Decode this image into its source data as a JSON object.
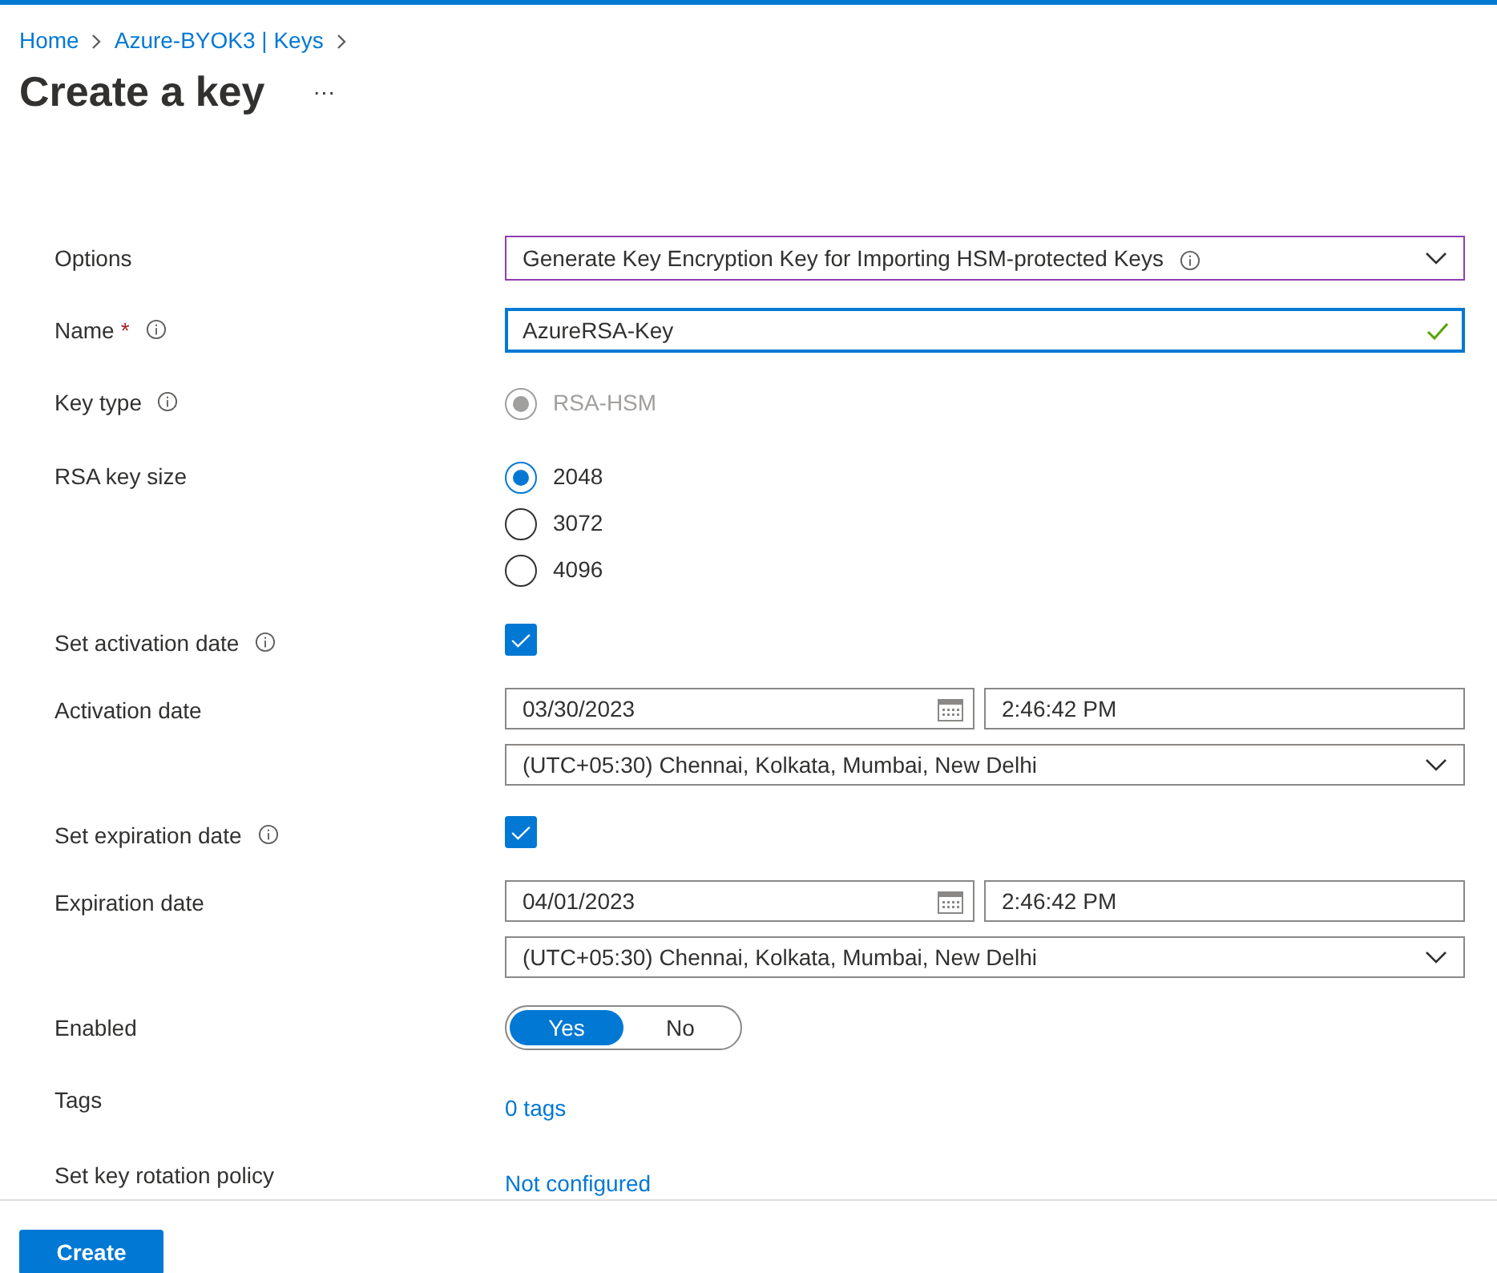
{
  "breadcrumb": [
    {
      "label": "Home"
    },
    {
      "label": "Azure-BYOK3 | Keys"
    }
  ],
  "title": "Create a key",
  "more": "···",
  "fields": [
    {
      "kind": "dropdown",
      "label": "Options",
      "value": "Generate Key Encryption Key for Importing HSM-protected Keys",
      "value_info": true
    },
    {
      "kind": "text",
      "label": "Name",
      "required_mark": "*",
      "info": true,
      "value": "AzureRSA-Key",
      "focused": true,
      "valid": true
    },
    {
      "kind": "radio",
      "label": "Key type",
      "info": true,
      "options": [
        {
          "label": "RSA-HSM",
          "selected": true,
          "disabled": true
        }
      ]
    },
    {
      "kind": "radio",
      "label": "RSA key size",
      "options": [
        {
          "label": "2048",
          "selected": true,
          "disabled": false
        },
        {
          "label": "3072",
          "selected": false,
          "disabled": false
        },
        {
          "label": "4096",
          "selected": false,
          "disabled": false
        }
      ]
    },
    {
      "kind": "checkbox",
      "label": "Set activation date",
      "info": true,
      "checked": true
    },
    {
      "kind": "datetime",
      "label": "Activation date",
      "date": "03/30/2023",
      "time": "2:46:42 PM",
      "timezone": "(UTC+05:30) Chennai, Kolkata, Mumbai, New Delhi"
    },
    {
      "kind": "checkbox",
      "label": "Set expiration date",
      "info": true,
      "checked": true
    },
    {
      "kind": "datetime",
      "label": "Expiration date",
      "date": "04/01/2023",
      "time": "2:46:42 PM",
      "timezone": "(UTC+05:30) Chennai, Kolkata, Mumbai, New Delhi"
    },
    {
      "kind": "toggle",
      "label": "Enabled",
      "options": [
        {
          "label": "Yes",
          "selected": true
        },
        {
          "label": "No",
          "selected": false
        }
      ]
    },
    {
      "kind": "link",
      "label": "Tags",
      "value": "0 tags"
    },
    {
      "kind": "link",
      "label": "Set key rotation policy",
      "value": "Not configured"
    }
  ],
  "create_button": "Create"
}
